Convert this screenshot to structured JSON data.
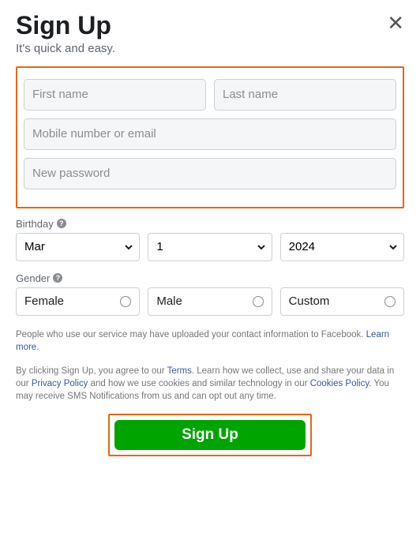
{
  "header": {
    "title": "Sign Up",
    "subtitle": "It's quick and easy."
  },
  "inputs": {
    "first_name_ph": "First name",
    "last_name_ph": "Last name",
    "contact_ph": "Mobile number or email",
    "password_ph": "New password"
  },
  "birthday": {
    "label": "Birthday",
    "month": "Mar",
    "day": "1",
    "year": "2024"
  },
  "gender": {
    "label": "Gender",
    "female": "Female",
    "male": "Male",
    "custom": "Custom"
  },
  "fine1_a": "People who use our service may have uploaded your contact information to Facebook. ",
  "fine1_link": "Learn more",
  "fine1_b": ".",
  "fine2_a": "By clicking Sign Up, you agree to our ",
  "fine2_terms": "Terms",
  "fine2_b": ". Learn how we collect, use and share your data in our ",
  "fine2_privacy": "Privacy Policy",
  "fine2_c": " and how we use cookies and similar technology in our ",
  "fine2_cookies": "Cookies Policy",
  "fine2_d": ". You may receive SMS Notifications from us and can opt out any time.",
  "submit_label": "Sign Up"
}
